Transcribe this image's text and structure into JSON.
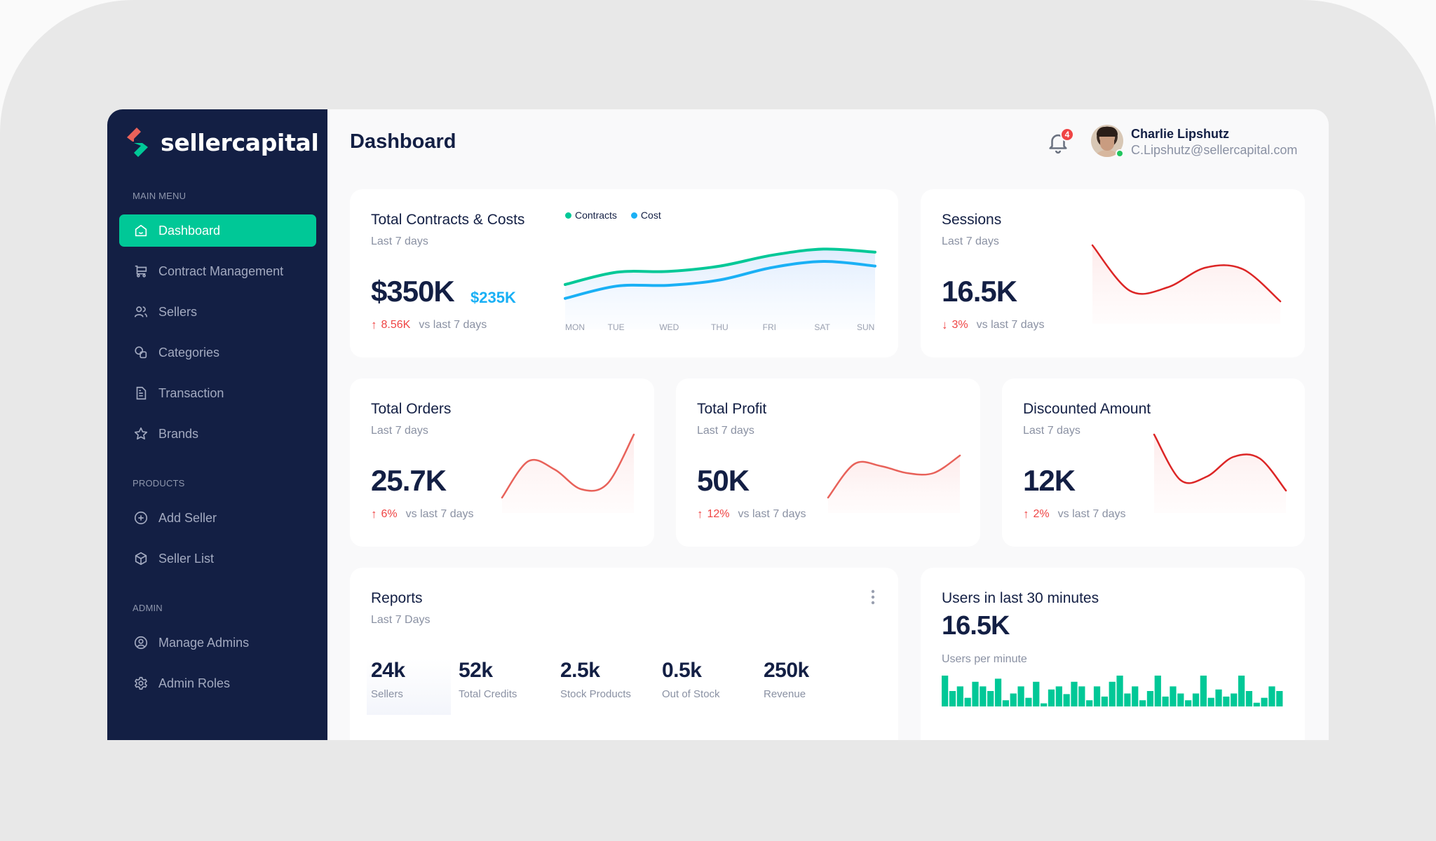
{
  "brand": {
    "name": "sellercapital",
    "logo_colors": {
      "primary": "#e8625a",
      "secondary": "#00c897"
    }
  },
  "sidebar": {
    "sections": [
      {
        "label": "MAIN MENU",
        "items": [
          {
            "label": "Dashboard",
            "icon": "home-icon",
            "active": true
          },
          {
            "label": "Contract Management",
            "icon": "cart-icon",
            "active": false
          },
          {
            "label": "Sellers",
            "icon": "users-icon",
            "active": false
          },
          {
            "label": "Categories",
            "icon": "categories-icon",
            "active": false
          },
          {
            "label": "Transaction",
            "icon": "document-icon",
            "active": false
          },
          {
            "label": "Brands",
            "icon": "star-icon",
            "active": false
          }
        ]
      },
      {
        "label": "PRODUCTS",
        "items": [
          {
            "label": "Add Seller",
            "icon": "plus-circle-icon",
            "active": false
          },
          {
            "label": "Seller List",
            "icon": "box-icon",
            "active": false
          }
        ]
      },
      {
        "label": "ADMIN",
        "items": [
          {
            "label": "Manage Admins",
            "icon": "user-circle-icon",
            "active": false
          },
          {
            "label": "Admin Roles",
            "icon": "gear-icon",
            "active": false
          }
        ]
      }
    ]
  },
  "header": {
    "title": "Dashboard",
    "notifications_count": "4",
    "user": {
      "name": "Charlie Lipshutz",
      "email": "C.Lipshutz@sellercapital.com",
      "status": "online"
    }
  },
  "colors": {
    "accent": "#00c897",
    "sidebar_bg": "#131f44",
    "text_dark": "#131f44",
    "negative": "#ef4444",
    "cost_blue": "#1ab0f5"
  },
  "cards": {
    "contracts": {
      "title": "Total Contracts & Costs",
      "subtitle": "Last 7 days",
      "value": "$350K",
      "secondary_value": "$235K",
      "trend_direction": "up",
      "trend_delta": "8.56K",
      "trend_text": "vs last 7 days"
    },
    "sessions": {
      "title": "Sessions",
      "subtitle": "Last 7 days",
      "value": "16.5K",
      "trend_direction": "down",
      "trend_delta": "3%",
      "trend_text": "vs last 7 days"
    },
    "orders": {
      "title": "Total Orders",
      "subtitle": "Last 7 days",
      "value": "25.7K",
      "trend_direction": "up",
      "trend_delta": "6%",
      "trend_text": "vs last 7 days"
    },
    "profit": {
      "title": "Total Profit",
      "subtitle": "Last 7 days",
      "value": "50K",
      "trend_direction": "up",
      "trend_delta": "12%",
      "trend_text": "vs last 7 days"
    },
    "discounted": {
      "title": "Discounted Amount",
      "subtitle": "Last 7 days",
      "value": "12K",
      "trend_direction": "up",
      "trend_delta": "2%",
      "trend_text": "vs last 7 days"
    },
    "reports": {
      "title": "Reports",
      "subtitle": "Last 7 Days",
      "menu_icon": "more-vertical-icon",
      "stats": [
        {
          "value": "24k",
          "label": "Sellers"
        },
        {
          "value": "52k",
          "label": "Total Credits"
        },
        {
          "value": "2.5k",
          "label": "Stock Products"
        },
        {
          "value": "0.5k",
          "label": "Out of Stock"
        },
        {
          "value": "250k",
          "label": "Revenue"
        }
      ]
    },
    "users": {
      "title": "Users in last 30 minutes",
      "value": "16.5K",
      "subtitle": "Users per minute"
    }
  },
  "chart_data": [
    {
      "id": "contracts-costs",
      "type": "line",
      "title": "Total Contracts & Costs",
      "categories": [
        "MON",
        "TUE",
        "WED",
        "THU",
        "FRI",
        "SAT",
        "SUN"
      ],
      "legend": "top",
      "series": [
        {
          "name": "Contracts",
          "color": "#00c897",
          "values": [
            40,
            56,
            57,
            64,
            78,
            86,
            82
          ]
        },
        {
          "name": "Cost",
          "color": "#1ab0f5",
          "values": [
            22,
            38,
            39,
            46,
            62,
            70,
            64
          ]
        }
      ],
      "ylim": [
        0,
        100
      ],
      "grid": false
    },
    {
      "id": "sessions-spark",
      "type": "line",
      "color": "#dc2626",
      "values": [
        100,
        35,
        40,
        68,
        66,
        20
      ],
      "ylim": [
        0,
        100
      ]
    },
    {
      "id": "orders-spark",
      "type": "line",
      "color": "#e8625a",
      "values": [
        10,
        62,
        50,
        22,
        30,
        100
      ],
      "ylim": [
        0,
        100
      ]
    },
    {
      "id": "profit-spark",
      "type": "line",
      "color": "#e8625a",
      "values": [
        10,
        58,
        55,
        45,
        45,
        70
      ],
      "ylim": [
        0,
        100
      ]
    },
    {
      "id": "discounted-spark",
      "type": "line",
      "color": "#dc2626",
      "values": [
        100,
        35,
        40,
        68,
        66,
        20
      ],
      "ylim": [
        0,
        100
      ]
    },
    {
      "id": "users-per-minute",
      "type": "bar",
      "color": "#00c897",
      "values": [
        1.0,
        0.5,
        0.65,
        0.28,
        0.8,
        0.65,
        0.5,
        0.9,
        0.2,
        0.42,
        0.65,
        0.28,
        0.8,
        0.1,
        0.55,
        0.65,
        0.4,
        0.8,
        0.65,
        0.2,
        0.65,
        0.32,
        0.8,
        1.0,
        0.42,
        0.65,
        0.2,
        0.5,
        1.0,
        0.32,
        0.65,
        0.42,
        0.2,
        0.42,
        1.0,
        0.28,
        0.55,
        0.32,
        0.42,
        1.0,
        0.5,
        0.12,
        0.28,
        0.65,
        0.5
      ],
      "ylim": [
        0,
        1
      ]
    }
  ]
}
